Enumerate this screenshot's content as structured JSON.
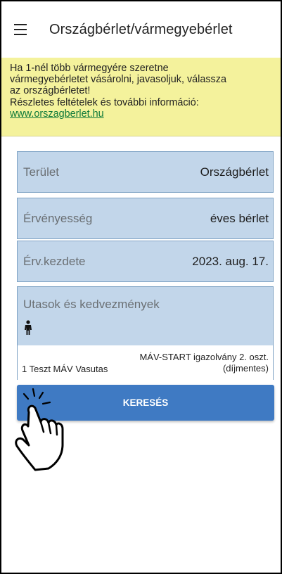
{
  "header": {
    "title": "Országbérlet/vármegyebérlet",
    "menu_icon": "hamburger-menu-icon"
  },
  "notice": {
    "line1": "Ha 1-nél több vármegyére szeretne",
    "line2": "vármegyebérletet vásárolni, javasoljuk, válassza",
    "line3": "az országbérletet!",
    "line4": "Részletes feltételek és további információ:",
    "link": "www.orszagberlet.hu",
    "background": "#f4f29c"
  },
  "form": {
    "area": {
      "label": "Terület",
      "value": "Országbérlet"
    },
    "validity": {
      "label": "Érvényesség",
      "value": "éves bérlet"
    },
    "start": {
      "label": "Érv.kezdete",
      "value": "2023. aug. 17."
    },
    "passengers": {
      "title": "Utasok és kedvezmények",
      "icon": "person-icon",
      "name": "1 Teszt MÁV Vasutas",
      "discount_line1": "MÁV-START igazolvány 2. oszt.",
      "discount_line2": "(díjmentes)"
    }
  },
  "search_button": {
    "label": "KERESÉS",
    "color": "#3f7ac3"
  },
  "overlay": {
    "icon": "tap-hand-icon"
  }
}
